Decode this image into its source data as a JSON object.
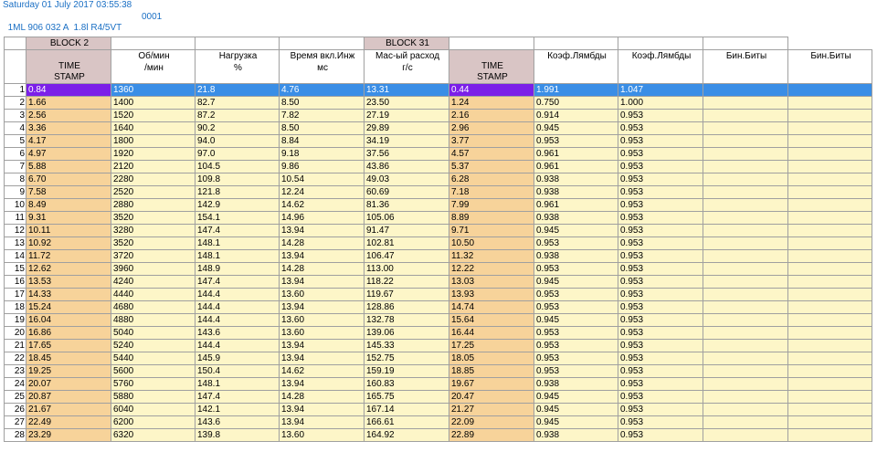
{
  "header": {
    "datetime": "Saturday 01 July 2017 03:55:38",
    "ecu_code": "1ML 906 032 A  1.8l R4/5VT",
    "ecu_num": "0001"
  },
  "blocks": [
    "BLOCK 2",
    "BLOCK 31"
  ],
  "columns": [
    {
      "line1": "TIME",
      "line2": "STAMP"
    },
    {
      "line1": "Об/мин",
      "line2": "/мин"
    },
    {
      "line1": "Нагрузка",
      "line2": "%"
    },
    {
      "line1": "Время вкл.Инж",
      "line2": "мс"
    },
    {
      "line1": "Мас-ый расход",
      "line2": "г/с"
    },
    {
      "line1": "TIME",
      "line2": "STAMP"
    },
    {
      "line1": "Коэф.Лямбды",
      "line2": ""
    },
    {
      "line1": "Коэф.Лямбды",
      "line2": ""
    },
    {
      "line1": "Бин.Биты",
      "line2": ""
    },
    {
      "line1": "Бин.Биты",
      "line2": ""
    }
  ],
  "selected_row": 1,
  "rows": [
    [
      "1",
      "0.84",
      "1360",
      "21.8",
      "4.76",
      "13.31",
      "0.44",
      "1.991",
      "1.047",
      "",
      ""
    ],
    [
      "2",
      "1.66",
      "1400",
      "82.7",
      "8.50",
      "23.50",
      "1.24",
      "0.750",
      "1.000",
      "",
      ""
    ],
    [
      "3",
      "2.56",
      "1520",
      "87.2",
      "7.82",
      "27.19",
      "2.16",
      "0.914",
      "0.953",
      "",
      ""
    ],
    [
      "4",
      "3.36",
      "1640",
      "90.2",
      "8.50",
      "29.89",
      "2.96",
      "0.945",
      "0.953",
      "",
      ""
    ],
    [
      "5",
      "4.17",
      "1800",
      "94.0",
      "8.84",
      "34.19",
      "3.77",
      "0.953",
      "0.953",
      "",
      ""
    ],
    [
      "6",
      "4.97",
      "1920",
      "97.0",
      "9.18",
      "37.56",
      "4.57",
      "0.961",
      "0.953",
      "",
      ""
    ],
    [
      "7",
      "5.88",
      "2120",
      "104.5",
      "9.86",
      "43.86",
      "5.37",
      "0.961",
      "0.953",
      "",
      ""
    ],
    [
      "8",
      "6.70",
      "2280",
      "109.8",
      "10.54",
      "49.03",
      "6.28",
      "0.938",
      "0.953",
      "",
      ""
    ],
    [
      "9",
      "7.58",
      "2520",
      "121.8",
      "12.24",
      "60.69",
      "7.18",
      "0.938",
      "0.953",
      "",
      ""
    ],
    [
      "10",
      "8.49",
      "2880",
      "142.9",
      "14.62",
      "81.36",
      "7.99",
      "0.961",
      "0.953",
      "",
      ""
    ],
    [
      "11",
      "9.31",
      "3520",
      "154.1",
      "14.96",
      "105.06",
      "8.89",
      "0.938",
      "0.953",
      "",
      ""
    ],
    [
      "12",
      "10.11",
      "3280",
      "147.4",
      "13.94",
      "91.47",
      "9.71",
      "0.945",
      "0.953",
      "",
      ""
    ],
    [
      "13",
      "10.92",
      "3520",
      "148.1",
      "14.28",
      "102.81",
      "10.50",
      "0.953",
      "0.953",
      "",
      ""
    ],
    [
      "14",
      "11.72",
      "3720",
      "148.1",
      "13.94",
      "106.47",
      "11.32",
      "0.938",
      "0.953",
      "",
      ""
    ],
    [
      "15",
      "12.62",
      "3960",
      "148.9",
      "14.28",
      "113.00",
      "12.22",
      "0.953",
      "0.953",
      "",
      ""
    ],
    [
      "16",
      "13.53",
      "4240",
      "147.4",
      "13.94",
      "118.22",
      "13.03",
      "0.945",
      "0.953",
      "",
      ""
    ],
    [
      "17",
      "14.33",
      "4440",
      "144.4",
      "13.60",
      "119.67",
      "13.93",
      "0.953",
      "0.953",
      "",
      ""
    ],
    [
      "18",
      "15.24",
      "4680",
      "144.4",
      "13.94",
      "128.86",
      "14.74",
      "0.953",
      "0.953",
      "",
      ""
    ],
    [
      "19",
      "16.04",
      "4880",
      "144.4",
      "13.60",
      "132.78",
      "15.64",
      "0.945",
      "0.953",
      "",
      ""
    ],
    [
      "20",
      "16.86",
      "5040",
      "143.6",
      "13.60",
      "139.06",
      "16.44",
      "0.953",
      "0.953",
      "",
      ""
    ],
    [
      "21",
      "17.65",
      "5240",
      "144.4",
      "13.94",
      "145.33",
      "17.25",
      "0.953",
      "0.953",
      "",
      ""
    ],
    [
      "22",
      "18.45",
      "5440",
      "145.9",
      "13.94",
      "152.75",
      "18.05",
      "0.953",
      "0.953",
      "",
      ""
    ],
    [
      "23",
      "19.25",
      "5600",
      "150.4",
      "14.62",
      "159.19",
      "18.85",
      "0.953",
      "0.953",
      "",
      ""
    ],
    [
      "24",
      "20.07",
      "5760",
      "148.1",
      "13.94",
      "160.83",
      "19.67",
      "0.938",
      "0.953",
      "",
      ""
    ],
    [
      "25",
      "20.87",
      "5880",
      "147.4",
      "14.28",
      "165.75",
      "20.47",
      "0.945",
      "0.953",
      "",
      ""
    ],
    [
      "26",
      "21.67",
      "6040",
      "142.1",
      "13.94",
      "167.14",
      "21.27",
      "0.945",
      "0.953",
      "",
      ""
    ],
    [
      "27",
      "22.49",
      "6200",
      "143.6",
      "13.94",
      "166.61",
      "22.09",
      "0.945",
      "0.953",
      "",
      ""
    ],
    [
      "28",
      "23.29",
      "6320",
      "139.8",
      "13.60",
      "164.92",
      "22.89",
      "0.938",
      "0.953",
      "",
      ""
    ]
  ]
}
